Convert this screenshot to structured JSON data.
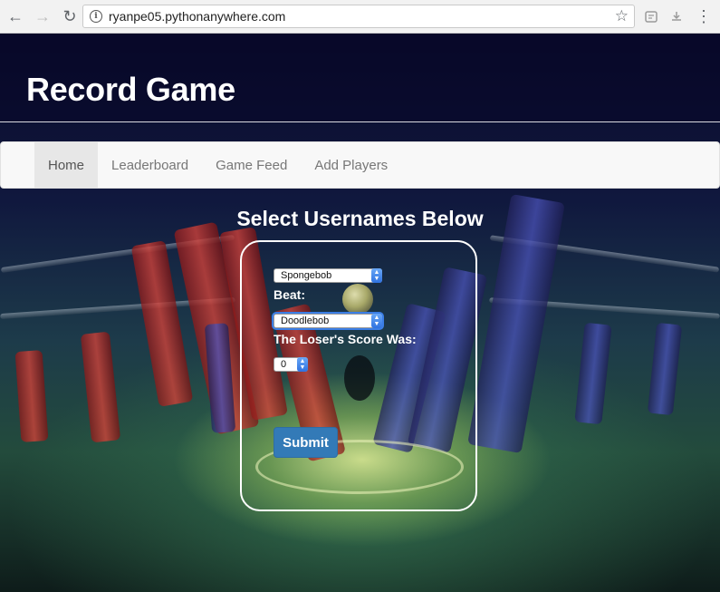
{
  "browser": {
    "url": "ryanpe05.pythonanywhere.com",
    "back_icon": "←",
    "forward_icon": "→",
    "reload_icon": "↻",
    "info_icon": "i",
    "star_icon": "☆",
    "menu_icon": "⋮"
  },
  "header": {
    "title": "Record Game"
  },
  "navbar": {
    "items": [
      {
        "label": "Home",
        "active": true
      },
      {
        "label": "Leaderboard",
        "active": false
      },
      {
        "label": "Game Feed",
        "active": false
      },
      {
        "label": "Add Players",
        "active": false
      }
    ]
  },
  "form": {
    "title": "Select Usernames Below",
    "winner_value": "Spongebob",
    "beat_label": "Beat:",
    "loser_value": "Doodlebob",
    "score_label": "The Loser's Score Was:",
    "score_value": "0",
    "submit_label": "Submit"
  },
  "colors": {
    "primary_button": "#337ab7",
    "navbar_bg": "#f8f8f8",
    "active_nav_bg": "#e7e7e7"
  }
}
